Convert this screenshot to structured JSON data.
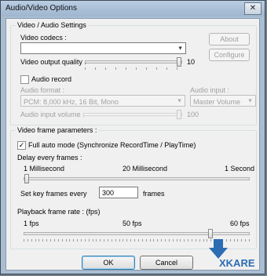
{
  "window": {
    "title": "Audio/Video Options",
    "close_glyph": "✕"
  },
  "av_settings": {
    "legend": "Video / Audio Settings",
    "video_codecs_label": "Video codecs :",
    "video_codec_value": "",
    "about_button": "About",
    "configure_button": "Configure",
    "video_quality_label": "Video output quality :",
    "video_quality_value": "10",
    "audio_record_label": "Audio record",
    "audio_record_checked": false,
    "audio_format_label": "Audio format :",
    "audio_format_value": "PCM: 8,000 kHz, 16 Bit, Mono",
    "audio_input_label": "Audio input :",
    "audio_input_value": "Master Volume",
    "audio_input_volume_label": "Audio input volume :",
    "audio_input_volume_value": "100"
  },
  "frame_params": {
    "legend": "Video frame parameters :",
    "full_auto_label": "Full auto mode (Synchronize  RecordTime / PlayTime)",
    "full_auto_checked": true,
    "delay_label": "Delay every frames :",
    "delay_min": "1 Millisecond",
    "delay_mid": "20 Millisecond",
    "delay_max": "1 Second",
    "keyframes_label": "Set key frames every",
    "keyframes_value": "300",
    "keyframes_unit": "frames",
    "playback_label": "Playback frame rate : (fps)",
    "fps_min": "1 fps",
    "fps_mid": "50 fps",
    "fps_max": "60 fps",
    "fps_value": 50
  },
  "footer": {
    "ok_button": "OK",
    "cancel_button": "Cancel"
  },
  "logo": {
    "text": "XKARE",
    "color": "#2b6cb3"
  }
}
